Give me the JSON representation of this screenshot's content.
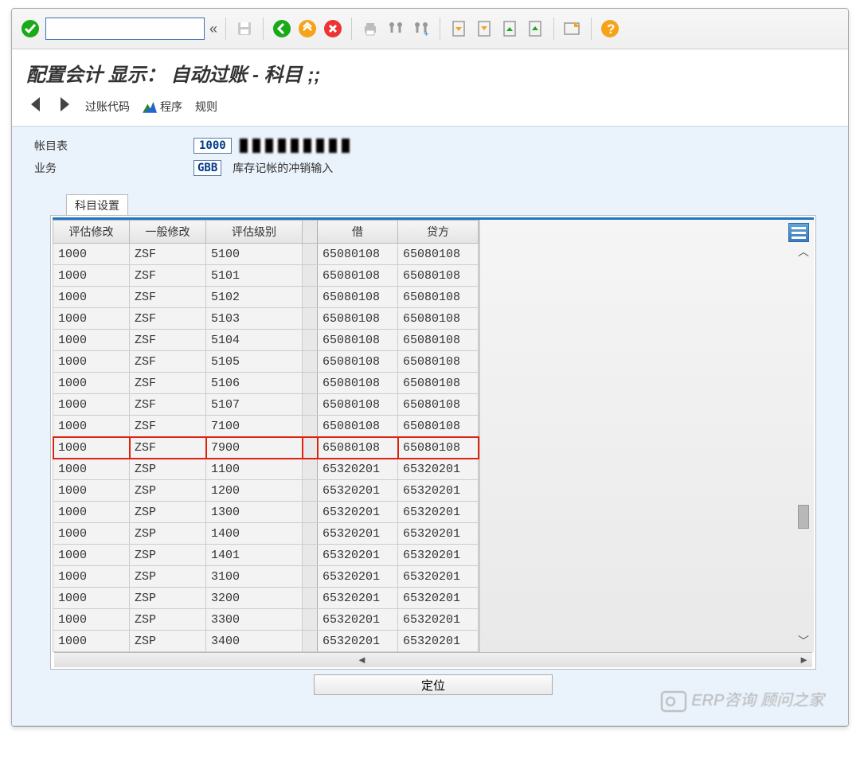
{
  "toolbar": {
    "ok": "✓",
    "chev": "«"
  },
  "title": "配置会计 显示： 自动过账 - 科目 ;;",
  "nav": {
    "posting_code": "过账代码",
    "program": "程序",
    "rules": "规则"
  },
  "form": {
    "chart_label": "帐目表",
    "chart_value": "1000",
    "biz_label": "业务",
    "biz_code": "GBB",
    "biz_text": "库存记帐的冲销输入"
  },
  "panel_title": "科目设置",
  "columns": [
    "评估修改",
    "一般修改",
    "评估级别",
    "借",
    "贷方"
  ],
  "rows": [
    {
      "c": [
        "1000",
        "ZSF",
        "5100",
        "65080108",
        "65080108"
      ]
    },
    {
      "c": [
        "1000",
        "ZSF",
        "5101",
        "65080108",
        "65080108"
      ]
    },
    {
      "c": [
        "1000",
        "ZSF",
        "5102",
        "65080108",
        "65080108"
      ]
    },
    {
      "c": [
        "1000",
        "ZSF",
        "5103",
        "65080108",
        "65080108"
      ]
    },
    {
      "c": [
        "1000",
        "ZSF",
        "5104",
        "65080108",
        "65080108"
      ]
    },
    {
      "c": [
        "1000",
        "ZSF",
        "5105",
        "65080108",
        "65080108"
      ]
    },
    {
      "c": [
        "1000",
        "ZSF",
        "5106",
        "65080108",
        "65080108"
      ]
    },
    {
      "c": [
        "1000",
        "ZSF",
        "5107",
        "65080108",
        "65080108"
      ]
    },
    {
      "c": [
        "1000",
        "ZSF",
        "7100",
        "65080108",
        "65080108"
      ]
    },
    {
      "c": [
        "1000",
        "ZSF",
        "7900",
        "65080108",
        "65080108"
      ],
      "hl": true
    },
    {
      "c": [
        "1000",
        "ZSP",
        "1100",
        "65320201",
        "65320201"
      ]
    },
    {
      "c": [
        "1000",
        "ZSP",
        "1200",
        "65320201",
        "65320201"
      ]
    },
    {
      "c": [
        "1000",
        "ZSP",
        "1300",
        "65320201",
        "65320201"
      ]
    },
    {
      "c": [
        "1000",
        "ZSP",
        "1400",
        "65320201",
        "65320201"
      ]
    },
    {
      "c": [
        "1000",
        "ZSP",
        "1401",
        "65320201",
        "65320201"
      ]
    },
    {
      "c": [
        "1000",
        "ZSP",
        "3100",
        "65320201",
        "65320201"
      ]
    },
    {
      "c": [
        "1000",
        "ZSP",
        "3200",
        "65320201",
        "65320201"
      ]
    },
    {
      "c": [
        "1000",
        "ZSP",
        "3300",
        "65320201",
        "65320201"
      ]
    },
    {
      "c": [
        "1000",
        "ZSP",
        "3400",
        "65320201",
        "65320201"
      ]
    }
  ],
  "locate": "定位",
  "watermark": "ERP咨询 顾问之家"
}
